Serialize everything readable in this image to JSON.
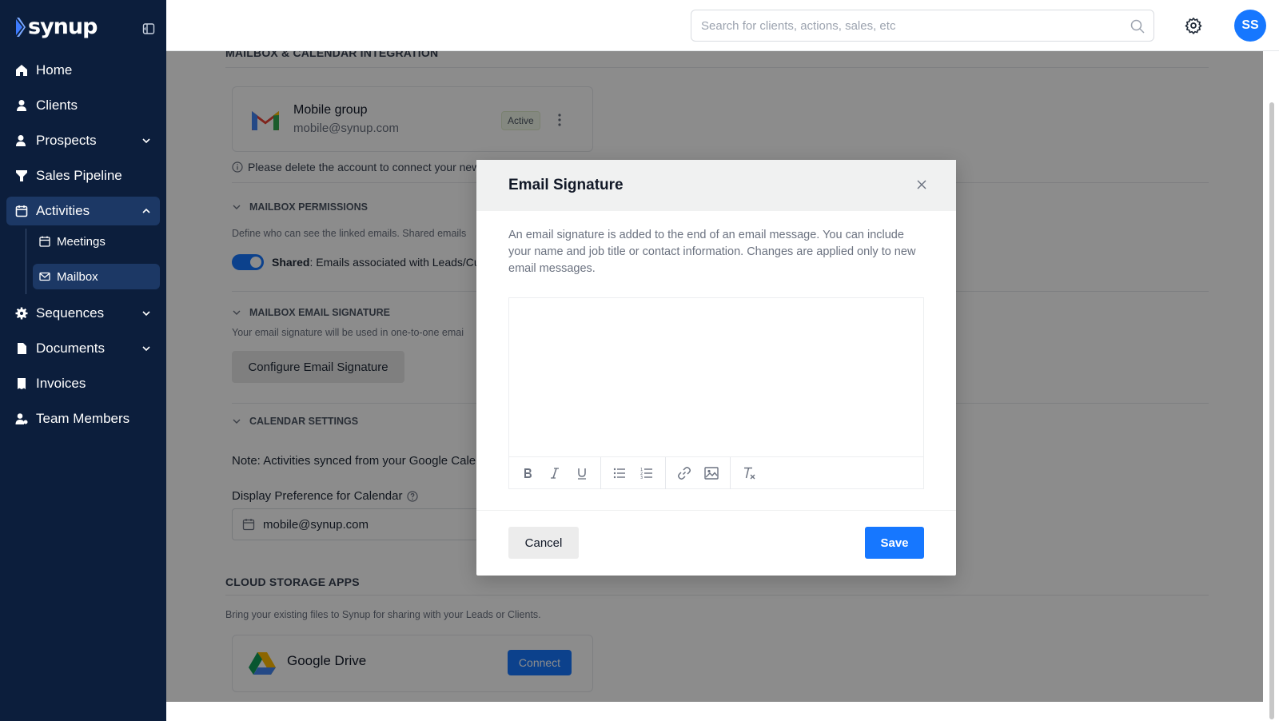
{
  "app": {
    "brand": "synup"
  },
  "colors": {
    "sidebar_bg": "#0c1e3c",
    "sidebar_active": "#1c3865",
    "accent": "#1677ff",
    "overlay": "rgba(0,0,0,0.45)"
  },
  "sidebar": {
    "items": [
      {
        "label": "Home",
        "icon": "home-icon"
      },
      {
        "label": "Clients",
        "icon": "user-icon"
      },
      {
        "label": "Prospects",
        "icon": "user-icon"
      },
      {
        "label": "Sales Pipeline",
        "icon": "funnel-icon"
      },
      {
        "label": "Activities",
        "icon": "calendar-icon"
      },
      {
        "label": "Sequences",
        "icon": "cog-icon"
      },
      {
        "label": "Documents",
        "icon": "document-icon"
      },
      {
        "label": "Invoices",
        "icon": "invoice-icon"
      },
      {
        "label": "Team Members",
        "icon": "team-icon"
      }
    ],
    "sub_items": [
      {
        "label": "Meetings",
        "icon": "calendar-icon"
      },
      {
        "label": "Mailbox",
        "icon": "mail-icon"
      }
    ]
  },
  "header": {
    "search_placeholder": "Search for clients, actions, sales, etc",
    "avatar_initials": "SS"
  },
  "page": {
    "mailbox_section_title": "MAILBOX & CALENDAR INTEGRATION",
    "account": {
      "name": "Mobile group",
      "email": "mobile@synup.com",
      "status": "Active"
    },
    "delete_note": "Please delete the account to connect your new",
    "permissions_title": "MAILBOX PERMISSIONS",
    "permissions_desc": "Define who can see the linked emails. Shared emails",
    "shared_label": "Shared",
    "shared_desc": ": Emails associated with Leads/Cu",
    "signature_title": "MAILBOX EMAIL SIGNATURE",
    "signature_desc": "Your email signature will be used in one-to-one emai",
    "configure_button": "Configure Email Signature",
    "calendar_title": "CALENDAR SETTINGS",
    "calendar_note": "Note: Activities synced from your Google Cale",
    "display_pref_label": "Display Preference for Calendar",
    "calendar_select_value": "mobile@synup.com",
    "cloud_title": "CLOUD STORAGE APPS",
    "cloud_desc": "Bring your existing files to Synup for sharing with your Leads or Clients.",
    "drive_name": "Google Drive",
    "connect_button": "Connect"
  },
  "modal": {
    "title": "Email Signature",
    "description": "An email signature is added to the end of an email message. You can include your name and job title or contact information. Changes are applied only to new email messages.",
    "cancel": "Cancel",
    "save": "Save",
    "toolbar": [
      "bold-icon",
      "italic-icon",
      "underline-icon",
      "bullet-list-icon",
      "numbered-list-icon",
      "link-icon",
      "image-icon",
      "clear-format-icon"
    ]
  }
}
